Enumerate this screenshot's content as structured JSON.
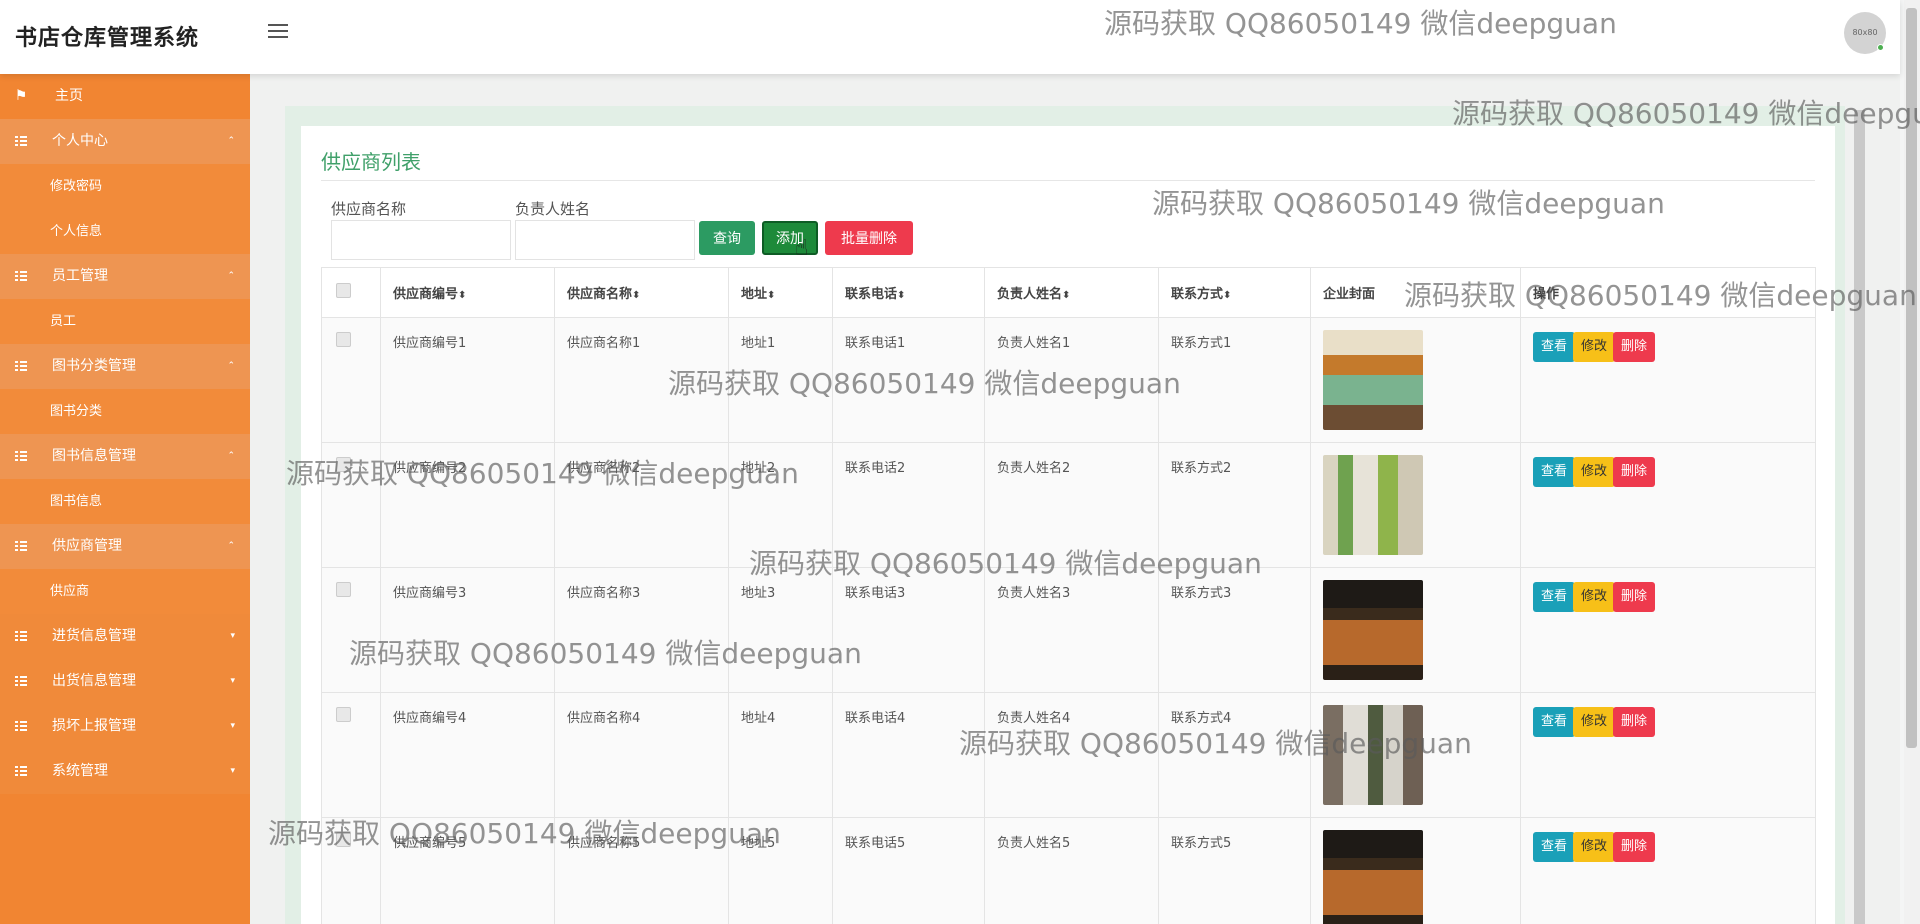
{
  "app": {
    "title": "书店仓库管理系统",
    "avatar_text": "80x80"
  },
  "sidebar": {
    "items": [
      {
        "label": "主页",
        "type": "home"
      },
      {
        "label": "个人中心",
        "type": "parent",
        "caret": "⌃"
      },
      {
        "label": "修改密码",
        "type": "child"
      },
      {
        "label": "个人信息",
        "type": "child"
      },
      {
        "label": "员工管理",
        "type": "parent",
        "caret": "⌃"
      },
      {
        "label": "员工",
        "type": "child"
      },
      {
        "label": "图书分类管理",
        "type": "parent",
        "caret": "⌃"
      },
      {
        "label": "图书分类",
        "type": "child"
      },
      {
        "label": "图书信息管理",
        "type": "parent",
        "caret": "⌃"
      },
      {
        "label": "图书信息",
        "type": "child"
      },
      {
        "label": "供应商管理",
        "type": "parent",
        "caret": "⌃"
      },
      {
        "label": "供应商",
        "type": "child"
      },
      {
        "label": "进货信息管理",
        "type": "parent",
        "caret": "▾"
      },
      {
        "label": "出货信息管理",
        "type": "parent",
        "caret": "▾"
      },
      {
        "label": "损坏上报管理",
        "type": "parent",
        "caret": "▾"
      },
      {
        "label": "系统管理",
        "type": "parent",
        "caret": "▾"
      }
    ]
  },
  "page": {
    "title": "供应商列表",
    "search": {
      "supplier_name_label": "供应商名称",
      "supplier_name_value": "",
      "contact_name_label": "负责人姓名",
      "contact_name_value": ""
    },
    "buttons": {
      "query": "查询",
      "add": "添加",
      "batch_delete": "批量删除"
    },
    "table": {
      "headers": [
        "供应商编号",
        "供应商名称",
        "地址",
        "联系电话",
        "负责人姓名",
        "联系方式",
        "企业封面",
        "操作"
      ],
      "sort_glyph": "⬍",
      "actions": {
        "view": "查看",
        "edit": "修改",
        "delete": "删除"
      },
      "rows": [
        {
          "code": "供应商编号1",
          "name": "供应商名称1",
          "address": "地址1",
          "phone": "联系电话1",
          "contact": "负责人姓名1",
          "method": "联系方式1",
          "cover": "store-cover-1"
        },
        {
          "code": "供应商编号2",
          "name": "供应商名称2",
          "address": "地址2",
          "phone": "联系电话2",
          "contact": "负责人姓名2",
          "method": "联系方式2",
          "cover": "store-cover-2"
        },
        {
          "code": "供应商编号3",
          "name": "供应商名称3",
          "address": "地址3",
          "phone": "联系电话3",
          "contact": "负责人姓名3",
          "method": "联系方式3",
          "cover": "store-cover-3"
        },
        {
          "code": "供应商编号4",
          "name": "供应商名称4",
          "address": "地址4",
          "phone": "联系电话4",
          "contact": "负责人姓名4",
          "method": "联系方式4",
          "cover": "store-cover-4"
        },
        {
          "code": "供应商编号5",
          "name": "供应商名称5",
          "address": "地址5",
          "phone": "联系电话5",
          "contact": "负责人姓名5",
          "method": "联系方式5",
          "cover": "store-cover-5"
        }
      ]
    }
  },
  "watermark": {
    "text": "源码获取 QQ86050149 微信deepguan",
    "count": 10
  },
  "colors": {
    "sidebar_bg": "#f18532",
    "title_green": "#40a06a",
    "query_green": "#2c9b62",
    "add_green": "#1d8a3a",
    "danger_red": "#ee3a4d",
    "view_cyan": "#1aa0b8",
    "edit_yellow": "#f7c018"
  }
}
